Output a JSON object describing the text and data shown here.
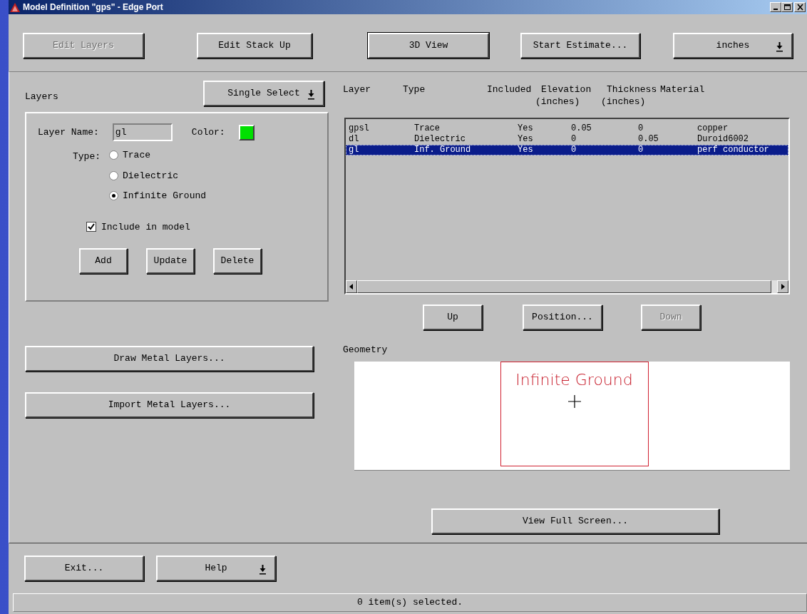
{
  "window": {
    "title": "Model Definition \"gps\" - Edge Port"
  },
  "toolbar": [
    {
      "kind": "button",
      "label": "Edit Layers",
      "disabled": true,
      "default": false
    },
    {
      "kind": "button",
      "label": "Edit Stack Up",
      "disabled": false,
      "default": false
    },
    {
      "kind": "button",
      "label": "3D View",
      "disabled": false,
      "default": true
    },
    {
      "kind": "button",
      "label": "Start Estimate...",
      "disabled": false,
      "default": false
    },
    {
      "kind": "dropdown",
      "label": "inches",
      "disabled": false,
      "default": false
    }
  ],
  "layers_panel": {
    "title": "Layers",
    "mode_dropdown": "Single Select",
    "layer_name_label": "Layer Name:",
    "layer_name": "gl",
    "color_label": "Color:",
    "color": "#00e000",
    "type_label": "Type:",
    "types": [
      {
        "label": "Trace",
        "selected": false
      },
      {
        "label": "Dielectric",
        "selected": false
      },
      {
        "label": "Infinite Ground",
        "selected": true
      }
    ],
    "include": {
      "label": "Include in model",
      "checked": true
    },
    "buttons": [
      "Add",
      "Update",
      "Delete"
    ]
  },
  "actions": [
    "Draw Metal Layers...",
    "Import Metal Layers..."
  ],
  "table": {
    "columns": [
      {
        "label": "Layer"
      },
      {
        "label": "Type"
      },
      {
        "label": "Included"
      },
      {
        "label": "Elevation",
        "unit": "(inches)"
      },
      {
        "label": "Thickness",
        "unit": "(inches)"
      },
      {
        "label": "Material"
      }
    ],
    "rows": [
      {
        "cells": [
          "gpsl",
          "Trace",
          "Yes",
          "0.05",
          "0",
          "copper"
        ],
        "selected": false
      },
      {
        "cells": [
          "dl",
          "Dielectric",
          "Yes",
          "0",
          "0.05",
          "Duroid6002"
        ],
        "selected": false
      },
      {
        "cells": [
          "gl",
          "Inf. Ground",
          "Yes",
          "0",
          "0",
          "perf conductor"
        ],
        "selected": true
      }
    ]
  },
  "move_buttons": [
    {
      "label": "Up",
      "disabled": false
    },
    {
      "label": "Position...",
      "disabled": false
    },
    {
      "label": "Down",
      "disabled": true
    }
  ],
  "geometry": {
    "title": "Geometry",
    "shape_label": "Infinite Ground"
  },
  "view_button": "View Full Screen...",
  "footer_buttons": [
    {
      "kind": "button",
      "label": "Exit..."
    },
    {
      "kind": "dropdown",
      "label": "Help"
    }
  ],
  "status_bar": "0 item(s) selected."
}
